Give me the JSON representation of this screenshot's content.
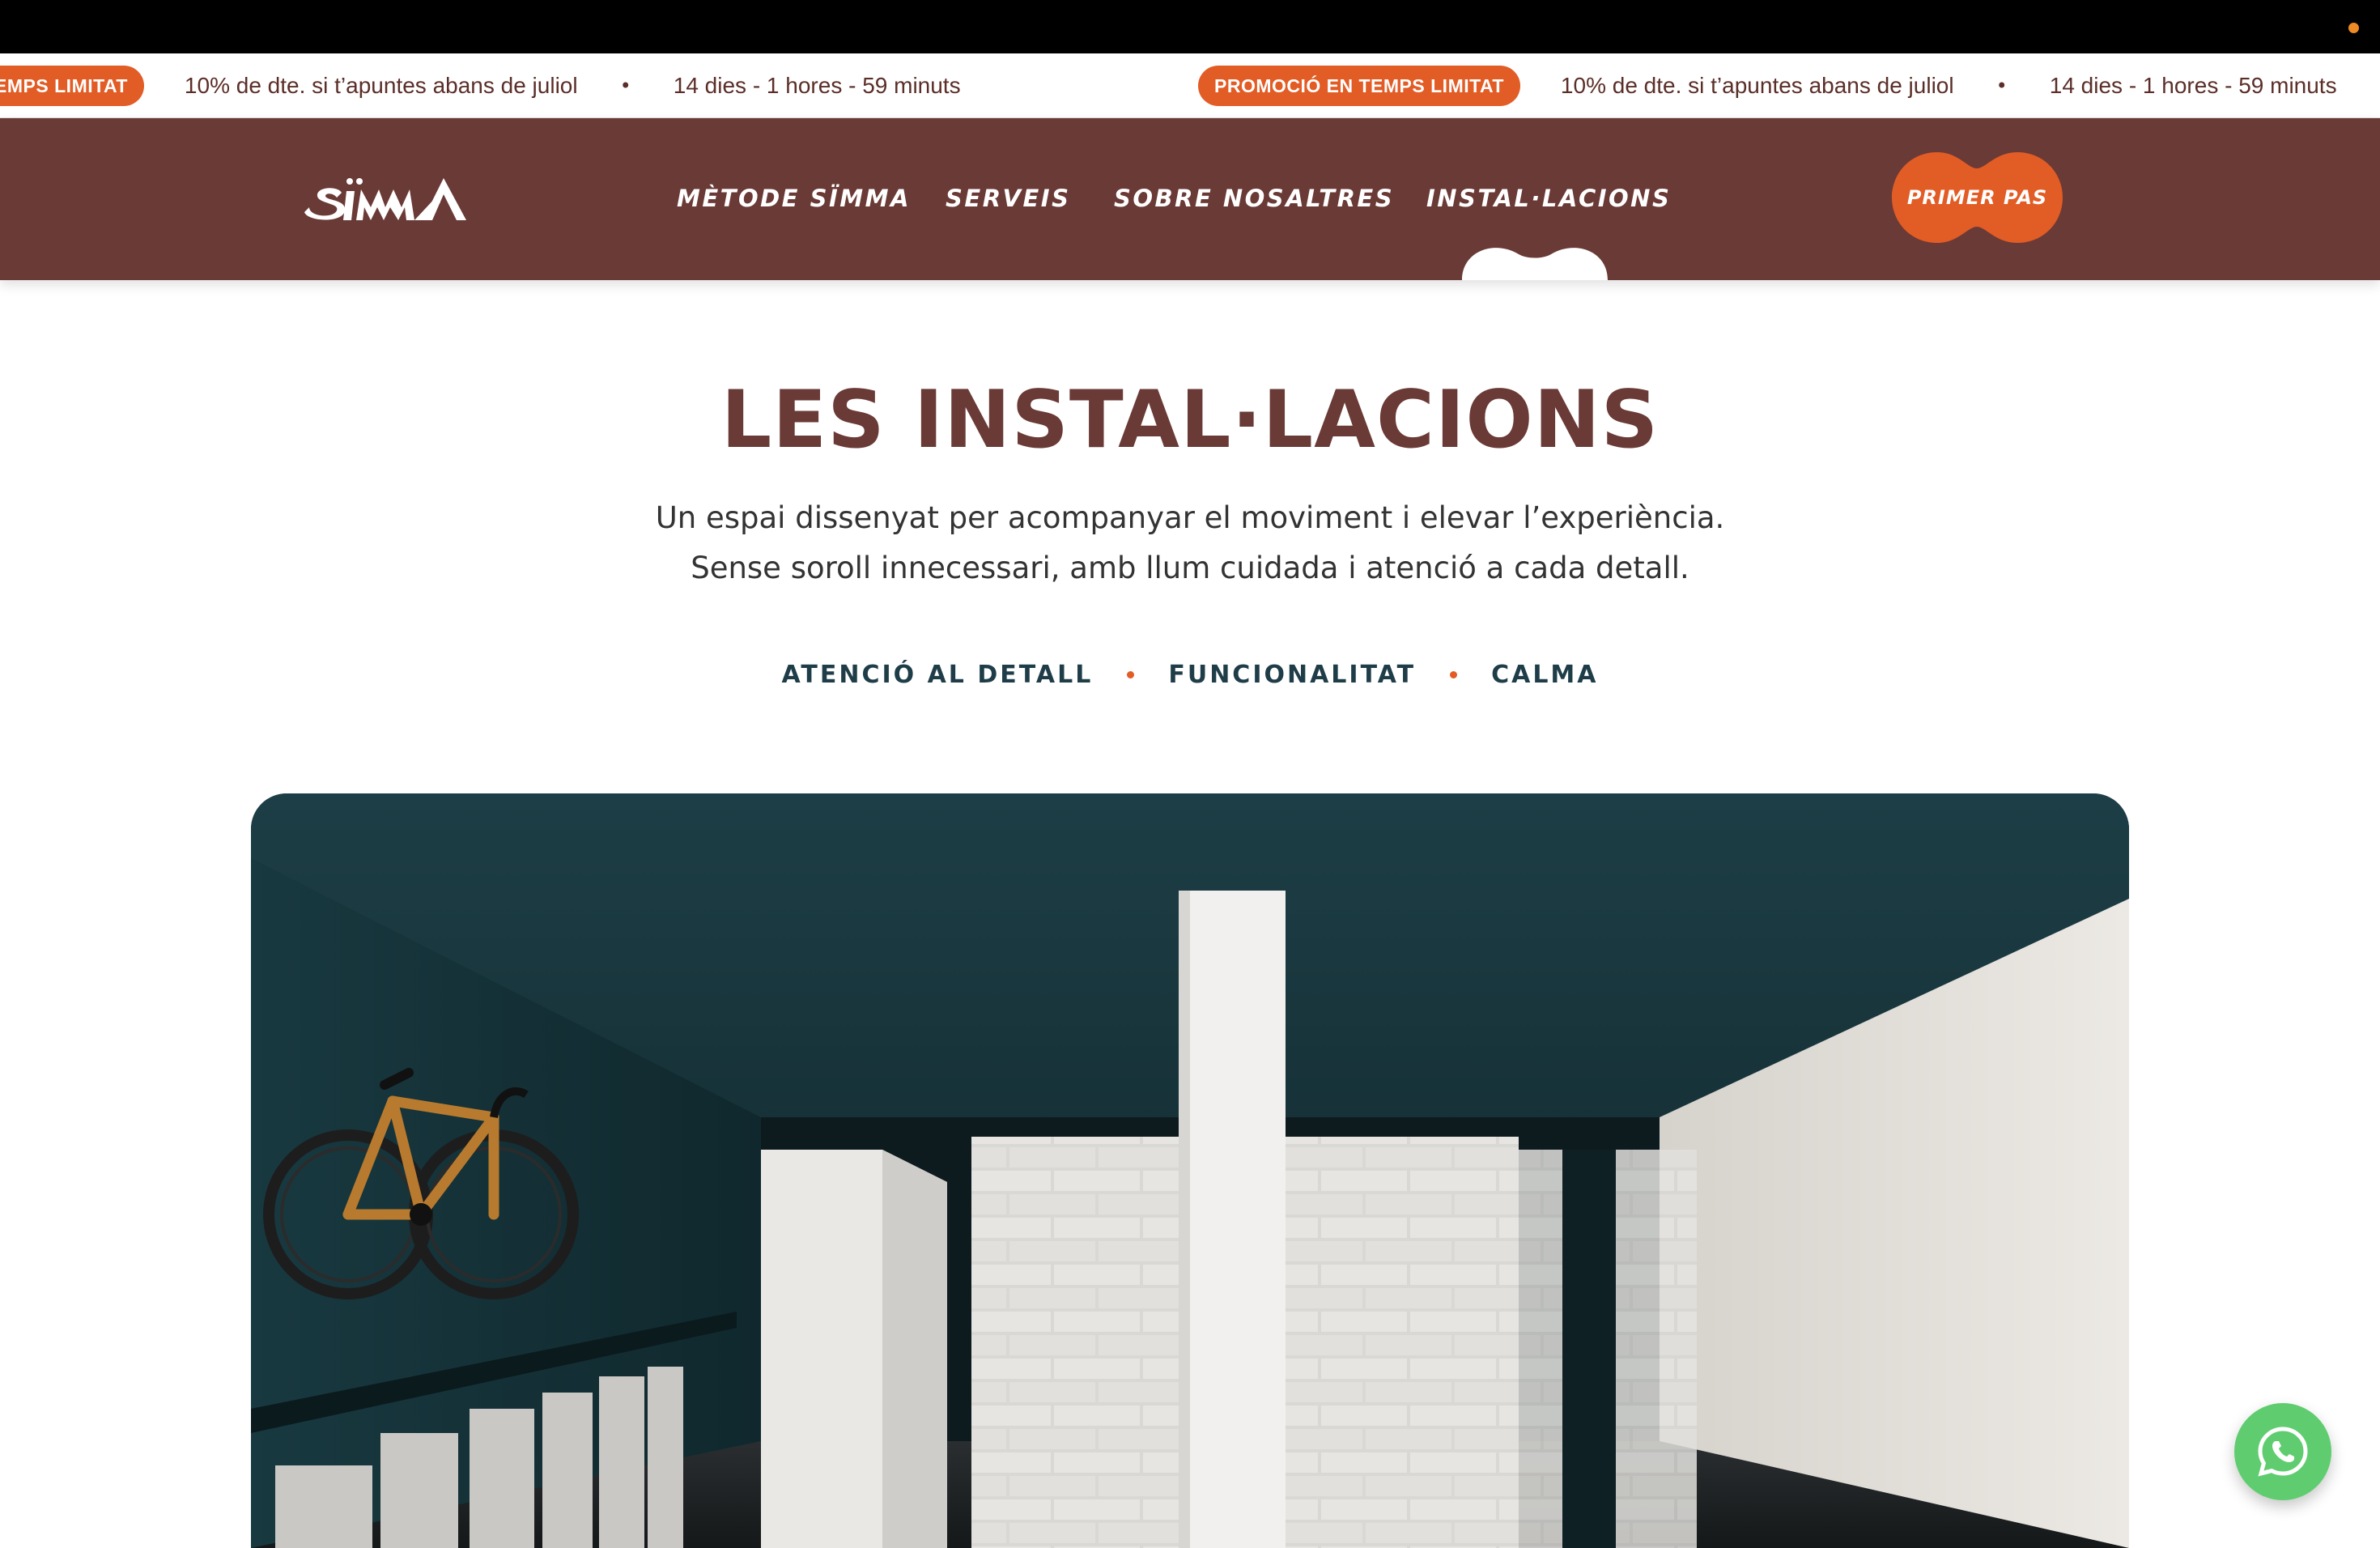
{
  "promo": {
    "badge": "PROMOCIÓ EN TEMPS LIMITAT",
    "badge_partial": "N TEMPS LIMITAT",
    "offer": "10% de dte. si t’apuntes abans de juliol",
    "bullet": "•",
    "countdown": "14 dies - 1 hores - 59 minuts"
  },
  "header": {
    "logo_alt": "SÏMMA",
    "nav": [
      {
        "label": "MÈTODE SÏMMA"
      },
      {
        "label": "SERVEIS"
      },
      {
        "label": "SOBRE NOSALTRES"
      },
      {
        "label": "INSTAL·LACIONS",
        "active": true
      }
    ],
    "cta_label": "PRIMER PAS"
  },
  "hero": {
    "title": "LES INSTAL·LACIONS",
    "subtitle_line1": "Un espai dissenyat per acompanyar el moviment i elevar l’experiència.",
    "subtitle_line2": "Sense soroll innecessari, amb llum cuidada i atenció a cada detall.",
    "tags": [
      "ATENCIÓ AL DETALL",
      "FUNCIONALITAT",
      "CALMA"
    ]
  },
  "photo": {
    "alt": "Interior de les instal·lacions amb bicicleta penjada a la paret"
  },
  "floating": {
    "whatsapp_icon": "whatsapp-icon"
  },
  "colors": {
    "brand_brown": "#6a3a36",
    "accent_orange": "#e25c25",
    "tag_teal": "#1f3d48",
    "whatsapp_green": "#5fcd6f"
  }
}
